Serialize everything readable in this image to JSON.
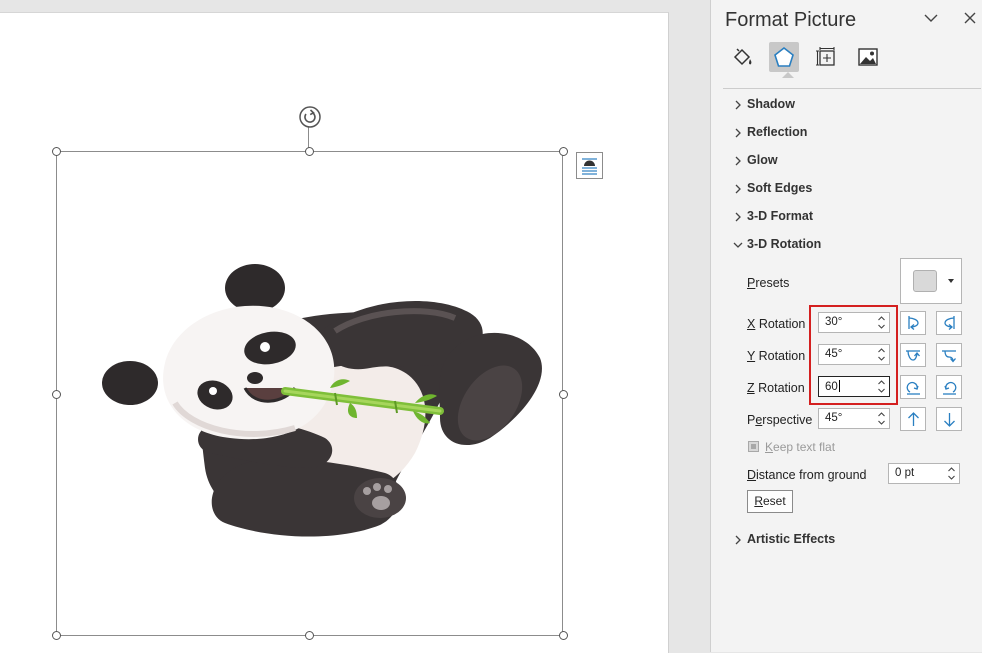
{
  "pane": {
    "title": "Format Picture",
    "tabs": [
      {
        "name": "fill-line",
        "icon": "paint-bucket-icon"
      },
      {
        "name": "effects",
        "icon": "pentagon-icon",
        "active": true
      },
      {
        "name": "size-properties",
        "icon": "size-icon"
      },
      {
        "name": "picture",
        "icon": "picture-icon"
      }
    ],
    "sections": {
      "shadow": "Shadow",
      "reflection": "Reflection",
      "glow": "Glow",
      "soft_edges": "Soft Edges",
      "format_3d": "3-D Format",
      "rotation_3d": "3-D Rotation",
      "artistic": "Artistic Effects"
    },
    "rotation": {
      "presets_label_key": "P",
      "presets_label_rest": "resets",
      "x_key": "X",
      "x_rest": " Rotation",
      "x_value": "30°",
      "y_key": "Y",
      "y_rest": " Rotation",
      "y_value": "45°",
      "z_key": "Z",
      "z_rest": " Rotation",
      "z_value": "60",
      "persp_pre": "P",
      "persp_key": "e",
      "persp_rest": "rspective",
      "persp_value": "45°",
      "keep_key": "K",
      "keep_rest": "eep text flat",
      "distance_key": "D",
      "distance_rest": "istance from ground",
      "distance_value": "0 pt",
      "reset_key": "R",
      "reset_rest": "eset"
    }
  },
  "colors": {
    "highlight": "#d41f1f",
    "rotate_icon": "#2a7fc1"
  }
}
